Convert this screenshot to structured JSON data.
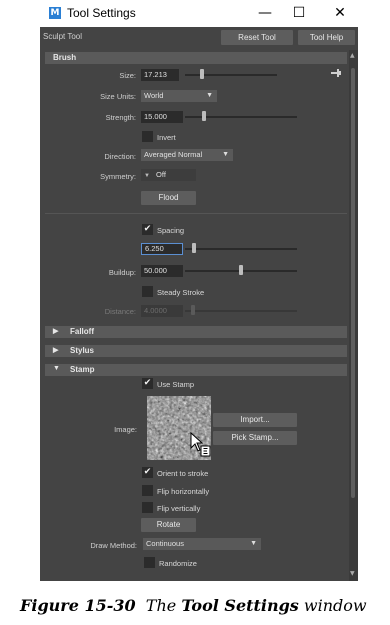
{
  "window": {
    "title": "Tool Settings",
    "app_icon": "M",
    "minimize_glyph": "—",
    "maximize_glyph": "☐",
    "close_glyph": "✕"
  },
  "toolbar": {
    "tool_name": "Sculpt Tool",
    "reset_label": "Reset Tool",
    "help_label": "Tool Help"
  },
  "brush": {
    "header": "Brush",
    "size_label": "Size:",
    "size_value": "17.213",
    "size_fraction": 0.45,
    "size_units_label": "Size Units:",
    "size_units_value": "World",
    "strength_label": "Strength:",
    "strength_value": "15.000",
    "strength_fraction": 0.15,
    "invert_label": "Invert",
    "invert_checked": false,
    "direction_label": "Direction:",
    "direction_value": "Averaged Normal",
    "symmetry_label": "Symmetry:",
    "symmetry_value": "Off",
    "flood_label": "Flood",
    "spacing_label": "Spacing",
    "spacing_checked": true,
    "spacing_value": "6.250",
    "spacing_fraction": 0.06,
    "buildup_label": "Buildup:",
    "buildup_value": "50.000",
    "buildup_fraction": 0.5,
    "steady_stroke_label": "Steady Stroke",
    "steady_stroke_checked": false,
    "distance_label": "Distance:",
    "distance_value": "4.0000",
    "distance_fraction": 0.04
  },
  "sections": {
    "falloff": "Falloff",
    "stylus": "Stylus",
    "stamp": "Stamp"
  },
  "stamp": {
    "use_stamp_label": "Use Stamp",
    "use_stamp_checked": true,
    "image_label": "Image:",
    "import_label": "Import...",
    "pick_stamp_label": "Pick Stamp...",
    "orient_label": "Orient to stroke",
    "orient_checked": true,
    "flip_h_label": "Flip horizontally",
    "flip_h_checked": false,
    "flip_v_label": "Flip vertically",
    "flip_v_checked": false,
    "rotate_label": "Rotate",
    "draw_method_label": "Draw Method:",
    "draw_method_value": "Continuous",
    "randomize_label": "Randomize",
    "randomize_checked": false
  },
  "icons": {
    "pin": "pin-icon",
    "expanded": "triangle-down-icon",
    "collapsed": "triangle-right-icon",
    "checkmark": "✔"
  },
  "caption": {
    "prefix": "Figure 15-30",
    "mid": "The",
    "bold": "Tool Settings",
    "suffix": "window"
  },
  "colors": {
    "panel": "#444444",
    "header": "#5a5a5a",
    "field": "#2b2b2b",
    "active_border": "#5b8fd2"
  }
}
